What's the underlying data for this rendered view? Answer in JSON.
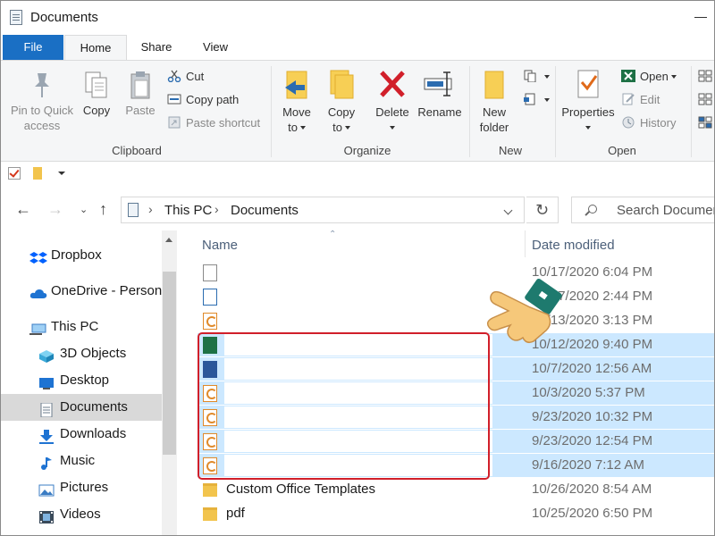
{
  "window": {
    "title": "Documents"
  },
  "tabs": [
    {
      "label": "File"
    },
    {
      "label": "Home"
    },
    {
      "label": "Share"
    },
    {
      "label": "View"
    }
  ],
  "ribbon": {
    "clipboard": {
      "pin_label_1": "Pin to Quick",
      "pin_label_2": "access",
      "copy_label": "Copy",
      "paste_label": "Paste",
      "cut_label": "Cut",
      "copy_path_label": "Copy path",
      "paste_shortcut_label": "Paste shortcut",
      "group_label": "Clipboard"
    },
    "organize": {
      "move_to_1": "Move",
      "move_to_2": "to",
      "copy_to_1": "Copy",
      "copy_to_2": "to",
      "delete_label": "Delete",
      "rename_label": "Rename",
      "group_label": "Organize"
    },
    "new": {
      "new_folder_1": "New",
      "new_folder_2": "folder",
      "group_label": "New"
    },
    "open": {
      "properties_label": "Properties",
      "open_label": "Open",
      "edit_label": "Edit",
      "history_label": "History",
      "group_label": "Open"
    }
  },
  "address": {
    "segments": [
      "This PC",
      "Documents"
    ]
  },
  "search": {
    "placeholder": "Search Documents"
  },
  "nav": {
    "items": [
      {
        "label": "Dropbox",
        "icon": "dropbox-icon"
      },
      {
        "label": "OneDrive - Personal",
        "icon": "onedrive-icon"
      },
      {
        "label": "This PC",
        "icon": "computer-icon"
      },
      {
        "label": "3D Objects",
        "icon": "3d-objects-icon"
      },
      {
        "label": "Desktop",
        "icon": "desktop-icon"
      },
      {
        "label": "Documents",
        "icon": "documents-icon"
      },
      {
        "label": "Downloads",
        "icon": "downloads-icon"
      },
      {
        "label": "Music",
        "icon": "music-icon"
      },
      {
        "label": "Pictures",
        "icon": "pictures-icon"
      },
      {
        "label": "Videos",
        "icon": "videos-icon"
      }
    ]
  },
  "files": {
    "col_name": "Name",
    "col_date": "Date modified",
    "rows": [
      {
        "name": "",
        "date": "10/17/2020 6:04 PM",
        "icon": "generic-file-icon",
        "selected": false
      },
      {
        "name": "",
        "date": "10/17/2020 2:44 PM",
        "icon": "image-file-icon",
        "selected": false
      },
      {
        "name": "",
        "date": "10/13/2020 3:13 PM",
        "icon": "pdf-file-icon",
        "selected": false
      },
      {
        "name": "",
        "date": "10/12/2020 9:40 PM",
        "icon": "excel-file-icon",
        "selected": true
      },
      {
        "name": "",
        "date": "10/7/2020 12:56 AM",
        "icon": "word-file-icon",
        "selected": true
      },
      {
        "name": "",
        "date": "10/3/2020 5:37 PM",
        "icon": "pdf-file-icon",
        "selected": true
      },
      {
        "name": "",
        "date": "9/23/2020 10:32 PM",
        "icon": "pdf-file-icon",
        "selected": true
      },
      {
        "name": "",
        "date": "9/23/2020 12:54 PM",
        "icon": "pdf-file-icon",
        "selected": true
      },
      {
        "name": "",
        "date": "9/16/2020 7:12 AM",
        "icon": "pdf-file-icon",
        "selected": true
      },
      {
        "name": "Custom Office Templates",
        "date": "10/26/2020 8:54 AM",
        "icon": "folder-icon",
        "selected": false
      },
      {
        "name": "pdf",
        "date": "10/25/2020 6:50 PM",
        "icon": "folder-icon",
        "selected": false
      }
    ]
  },
  "colors": {
    "accent": "#1a6fc4",
    "selection": "#cce8ff",
    "highlight_box": "#d11f2a"
  }
}
